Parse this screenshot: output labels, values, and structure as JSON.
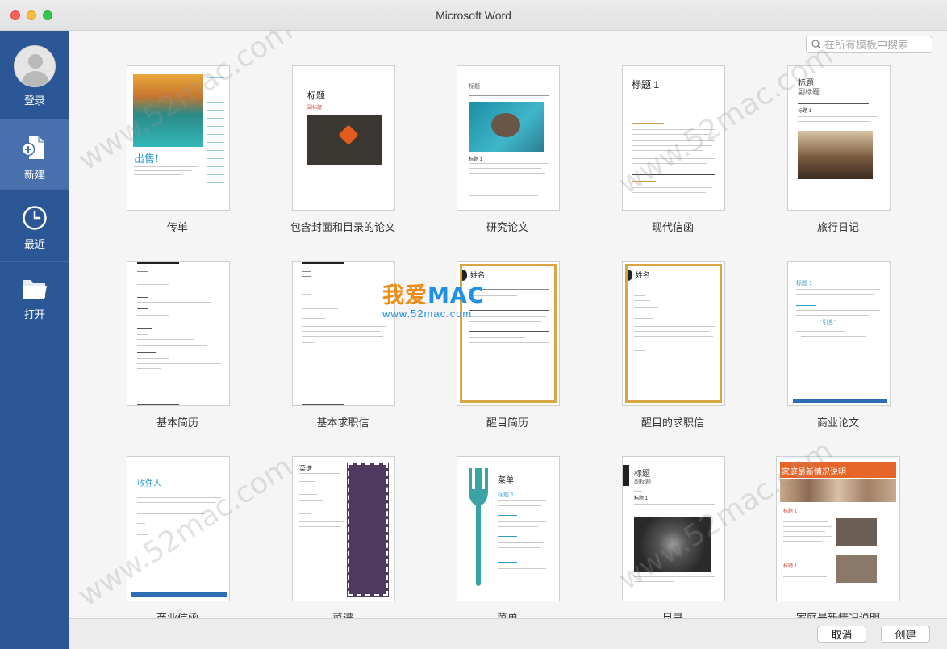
{
  "window": {
    "title": "Microsoft Word"
  },
  "sidebar": {
    "items": [
      {
        "label": "登录",
        "icon": "user-avatar-icon"
      },
      {
        "label": "新建",
        "icon": "new-document-icon",
        "active": true
      },
      {
        "label": "最近",
        "icon": "clock-icon"
      },
      {
        "label": "打开",
        "icon": "folder-icon"
      }
    ]
  },
  "search": {
    "placeholder": "在所有模板中搜索"
  },
  "templates": [
    {
      "label": "传单",
      "title": "出售!"
    },
    {
      "label": "包含封面和目录的论文",
      "title": "标题",
      "subtitle": "副标题"
    },
    {
      "label": "研究论文",
      "title": "标题",
      "heading": "标题 1"
    },
    {
      "label": "现代信函",
      "title": "标题 1"
    },
    {
      "label": "旅行日记",
      "title": "标题",
      "subtitle": "副标题",
      "heading": "标题 1"
    },
    {
      "label": "基本简历"
    },
    {
      "label": "基本求职信"
    },
    {
      "label": "醒目简历",
      "title": "姓名"
    },
    {
      "label": "醒目的求职信",
      "title": "姓名"
    },
    {
      "label": "商业论文",
      "heading": "标题 1",
      "quote": "\"引言\""
    },
    {
      "label": "商业信函",
      "title": "收件人"
    },
    {
      "label": "菜谱",
      "title": "菜谱"
    },
    {
      "label": "菜单",
      "title": "菜单",
      "heading": "标题 1"
    },
    {
      "label": "目录",
      "title": "标题",
      "subtitle": "副标题",
      "heading": "标题 1"
    },
    {
      "label": "家庭最新情况说明",
      "title": "家庭最新情况说明",
      "heading": "标题 1"
    }
  ],
  "footer": {
    "cancel": "取消",
    "create": "创建"
  },
  "watermark": {
    "brand": "我爱MAC",
    "brand_main": "我爱",
    "brand_mac": "MAC",
    "site": "www.52mac.com"
  },
  "colors": {
    "sidebar": "#2b5797",
    "accent": "#2f9bc9",
    "menu_purple": "#4e3a5e",
    "fork_teal": "#3aa3a3",
    "gold": "#d9a441"
  }
}
